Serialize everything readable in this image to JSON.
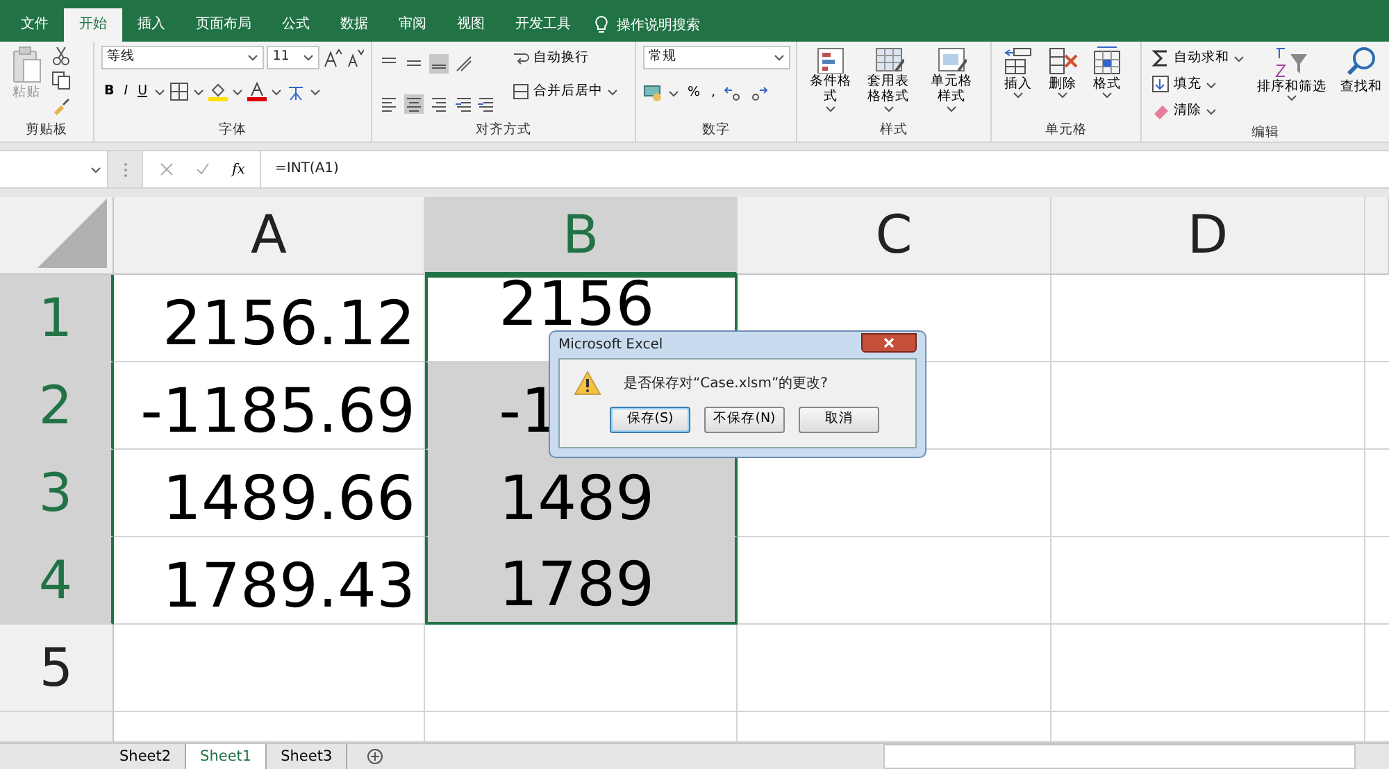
{
  "tabs": [
    {
      "label": "文件",
      "selected": false
    },
    {
      "label": "开始",
      "selected": true
    },
    {
      "label": "插入",
      "selected": false
    },
    {
      "label": "页面布局",
      "selected": false
    },
    {
      "label": "公式",
      "selected": false
    },
    {
      "label": "数据",
      "selected": false
    },
    {
      "label": "审阅",
      "selected": false
    },
    {
      "label": "视图",
      "selected": false
    },
    {
      "label": "开发工具",
      "selected": false
    }
  ],
  "search": {
    "label": "操作说明搜索"
  },
  "ribbon": {
    "clipboard": {
      "label": "剪贴板",
      "paste": "粘贴"
    },
    "font": {
      "label": "字体",
      "font_name": "等线",
      "font_size": "11",
      "bold": "B",
      "italic": "I",
      "underline": "U"
    },
    "alignment": {
      "label": "对齐方式",
      "wrap": "自动换行",
      "merge": "合并后居中"
    },
    "number": {
      "label": "数字",
      "format": "常规",
      "percent": "%",
      "comma": ","
    },
    "styles": {
      "label": "样式",
      "buttons": [
        {
          "label": "条件格式",
          "kind": "conditional"
        },
        {
          "label": "套用表格格式",
          "kind": "table"
        },
        {
          "label": "单元格样式",
          "kind": "cellstyle"
        }
      ]
    },
    "cells": {
      "label": "单元格",
      "buttons": [
        {
          "label": "插入",
          "kind": "insert"
        },
        {
          "label": "删除",
          "kind": "delete"
        },
        {
          "label": "格式",
          "kind": "format"
        }
      ]
    },
    "editing": {
      "label": "编辑",
      "items": [
        {
          "label": "自动求和",
          "kind": "sum"
        },
        {
          "label": "填充",
          "kind": "fill"
        },
        {
          "label": "清除",
          "kind": "clear"
        }
      ],
      "sort": "排序和筛选",
      "find": "查找和"
    }
  },
  "formula_bar": {
    "fx": "fx",
    "formula": "=INT(A1)"
  },
  "grid": {
    "columns": [
      {
        "label": "A",
        "selected": false
      },
      {
        "label": "B",
        "selected": true
      },
      {
        "label": "C",
        "selected": false
      },
      {
        "label": "D",
        "selected": false
      }
    ],
    "rows": [
      {
        "label": "1",
        "selected": true,
        "cells": [
          {
            "text": "2156.12"
          },
          {
            "text": "2156"
          }
        ]
      },
      {
        "label": "2",
        "selected": true,
        "cells": [
          {
            "text": "-1185.69"
          },
          {
            "text": "-1"
          }
        ]
      },
      {
        "label": "3",
        "selected": true,
        "cells": [
          {
            "text": "1489.66"
          },
          {
            "text": "1489"
          }
        ]
      },
      {
        "label": "4",
        "selected": true,
        "cells": [
          {
            "text": "1789.43"
          },
          {
            "text": "1789"
          }
        ]
      },
      {
        "label": "5",
        "selected": false,
        "cells": []
      }
    ]
  },
  "sheets": [
    {
      "label": "Sheet2",
      "selected": false
    },
    {
      "label": "Sheet1",
      "selected": true
    },
    {
      "label": "Sheet3",
      "selected": false
    }
  ],
  "dialog": {
    "title": "Microsoft Excel",
    "message": "是否保存对“Case.xlsm”的更改?",
    "buttons": [
      {
        "label": "保存(S)",
        "selected": true
      },
      {
        "label": "不保存(N)",
        "selected": false
      },
      {
        "label": "取消",
        "selected": false
      }
    ]
  }
}
